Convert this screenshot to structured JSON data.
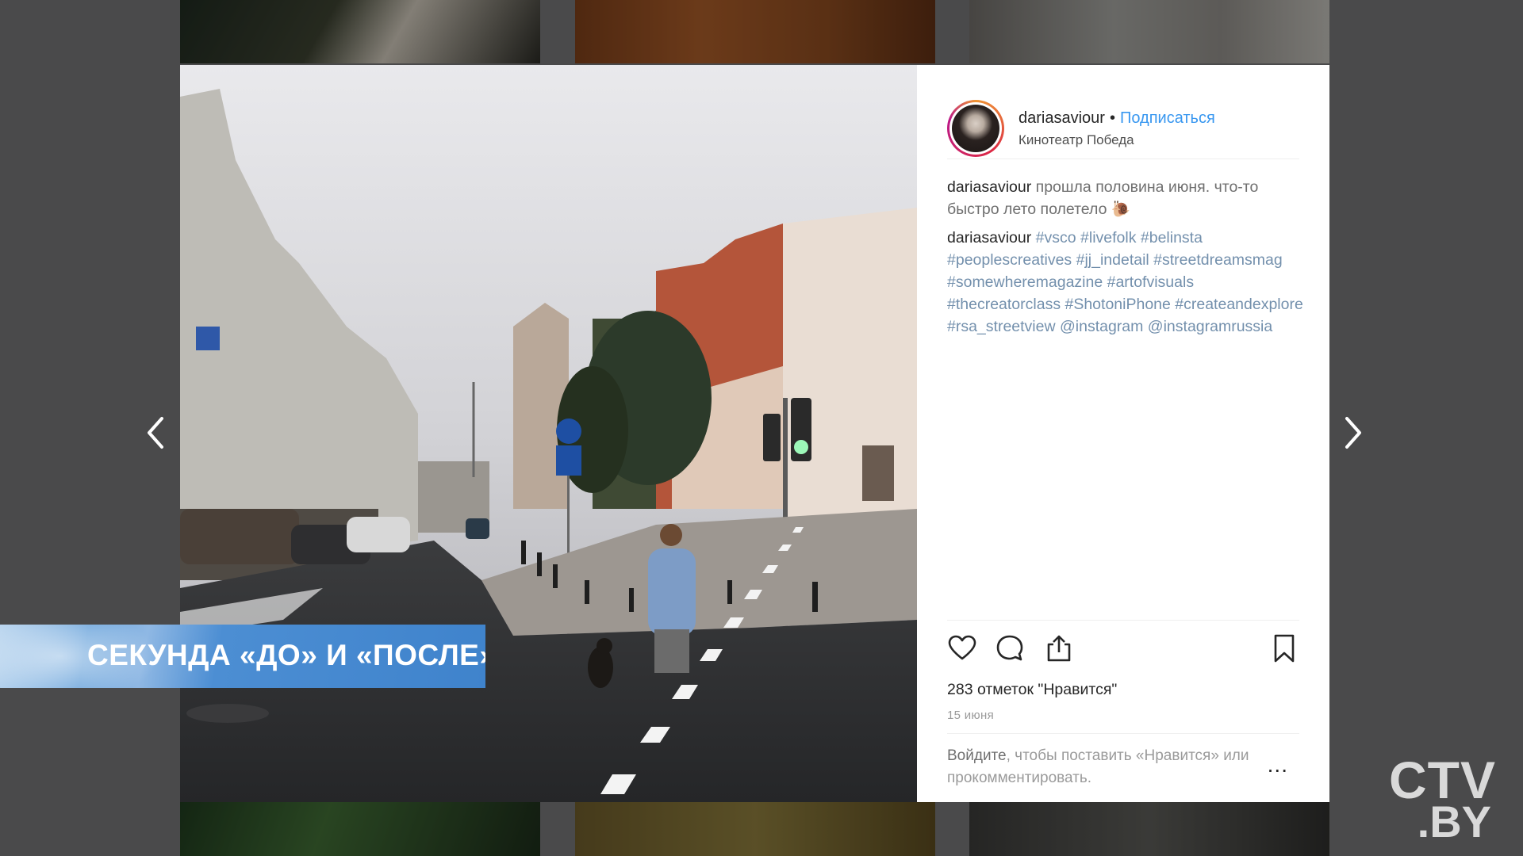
{
  "post": {
    "username": "dariasaviour",
    "separator": "•",
    "follow_label": "Подписаться",
    "location": "Кинотеатр Победа",
    "caption_user": "dariasaviour",
    "caption_text": "прошла половина июня. что-то быстро лето полетело 🐌",
    "tags_user": "dariasaviour",
    "tags_text": "#vsco #livefolk #belinsta #peoplescreatives #jj_indetail #streetdreamsmag #somewheremagazine #artofvisuals #thecreatorclass #ShotoniPhone #createandexplore #rsa_streetview @instagram @instagramrussia",
    "likes": "283 отметок \"Нравится\"",
    "date": "15 июня",
    "login_link": "Войдите",
    "login_text": ", чтобы поставить «Нравится» или прокомментировать.",
    "more": "..."
  },
  "icons": {
    "like": "heart-icon",
    "comment": "comment-icon",
    "share": "share-icon",
    "save": "bookmark-icon",
    "prev": "chevron-left-icon",
    "next": "chevron-right-icon"
  },
  "banner": {
    "text": "СЕКУНДА «ДО» И «ПОСЛЕ»"
  },
  "logo": {
    "line1": "CTV",
    "line2": ".BY"
  },
  "colors": {
    "link": "#3897f0",
    "text": "#262626",
    "muted": "#9a9a9a",
    "banner": "#4c8ed3"
  }
}
